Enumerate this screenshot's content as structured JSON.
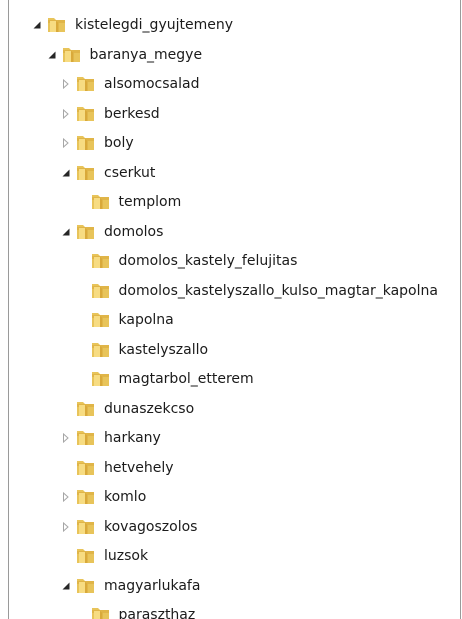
{
  "tree": {
    "items": [
      {
        "label": "kistelegdi_gyujtemeny",
        "level": 0,
        "state": "expanded",
        "icon": "folder-icon"
      },
      {
        "label": "baranya_megye",
        "level": 1,
        "state": "expanded",
        "icon": "folder-icon"
      },
      {
        "label": "alsomocsalad",
        "level": 2,
        "state": "collapsed",
        "icon": "folder-icon"
      },
      {
        "label": "berkesd",
        "level": 2,
        "state": "collapsed",
        "icon": "folder-icon"
      },
      {
        "label": "boly",
        "level": 2,
        "state": "collapsed",
        "icon": "folder-icon"
      },
      {
        "label": "cserkut",
        "level": 2,
        "state": "expanded",
        "icon": "folder-icon"
      },
      {
        "label": "templom",
        "level": 3,
        "state": "leaf",
        "icon": "folder-icon"
      },
      {
        "label": "domolos",
        "level": 2,
        "state": "expanded",
        "icon": "folder-icon"
      },
      {
        "label": "domolos_kastely_felujitas",
        "level": 3,
        "state": "leaf",
        "icon": "folder-icon"
      },
      {
        "label": "domolos_kastelyszallo_kulso_magtar_kapolna",
        "level": 3,
        "state": "leaf",
        "icon": "folder-icon"
      },
      {
        "label": "kapolna",
        "level": 3,
        "state": "leaf",
        "icon": "folder-icon"
      },
      {
        "label": "kastelyszallo",
        "level": 3,
        "state": "leaf",
        "icon": "folder-icon"
      },
      {
        "label": "magtarbol_etterem",
        "level": 3,
        "state": "leaf",
        "icon": "folder-icon"
      },
      {
        "label": "dunaszekcso",
        "level": 2,
        "state": "leaf",
        "icon": "folder-icon"
      },
      {
        "label": "harkany",
        "level": 2,
        "state": "collapsed",
        "icon": "folder-icon"
      },
      {
        "label": "hetvehely",
        "level": 2,
        "state": "leaf",
        "icon": "folder-icon"
      },
      {
        "label": "komlo",
        "level": 2,
        "state": "collapsed",
        "icon": "folder-icon"
      },
      {
        "label": "kovagoszolos",
        "level": 2,
        "state": "collapsed",
        "icon": "folder-icon"
      },
      {
        "label": "luzsok",
        "level": 2,
        "state": "leaf",
        "icon": "folder-icon"
      },
      {
        "label": "magyarlukafa",
        "level": 2,
        "state": "expanded",
        "icon": "folder-icon"
      },
      {
        "label": "paraszthaz",
        "level": 3,
        "state": "leaf",
        "icon": "folder-icon"
      }
    ]
  },
  "colors": {
    "folder_body": "#e8c45a",
    "folder_tab": "#d9a93a",
    "folder_front": "#f7dc82",
    "expanded_arrow": "#262626",
    "collapsed_arrow": "#a6a6a6"
  }
}
